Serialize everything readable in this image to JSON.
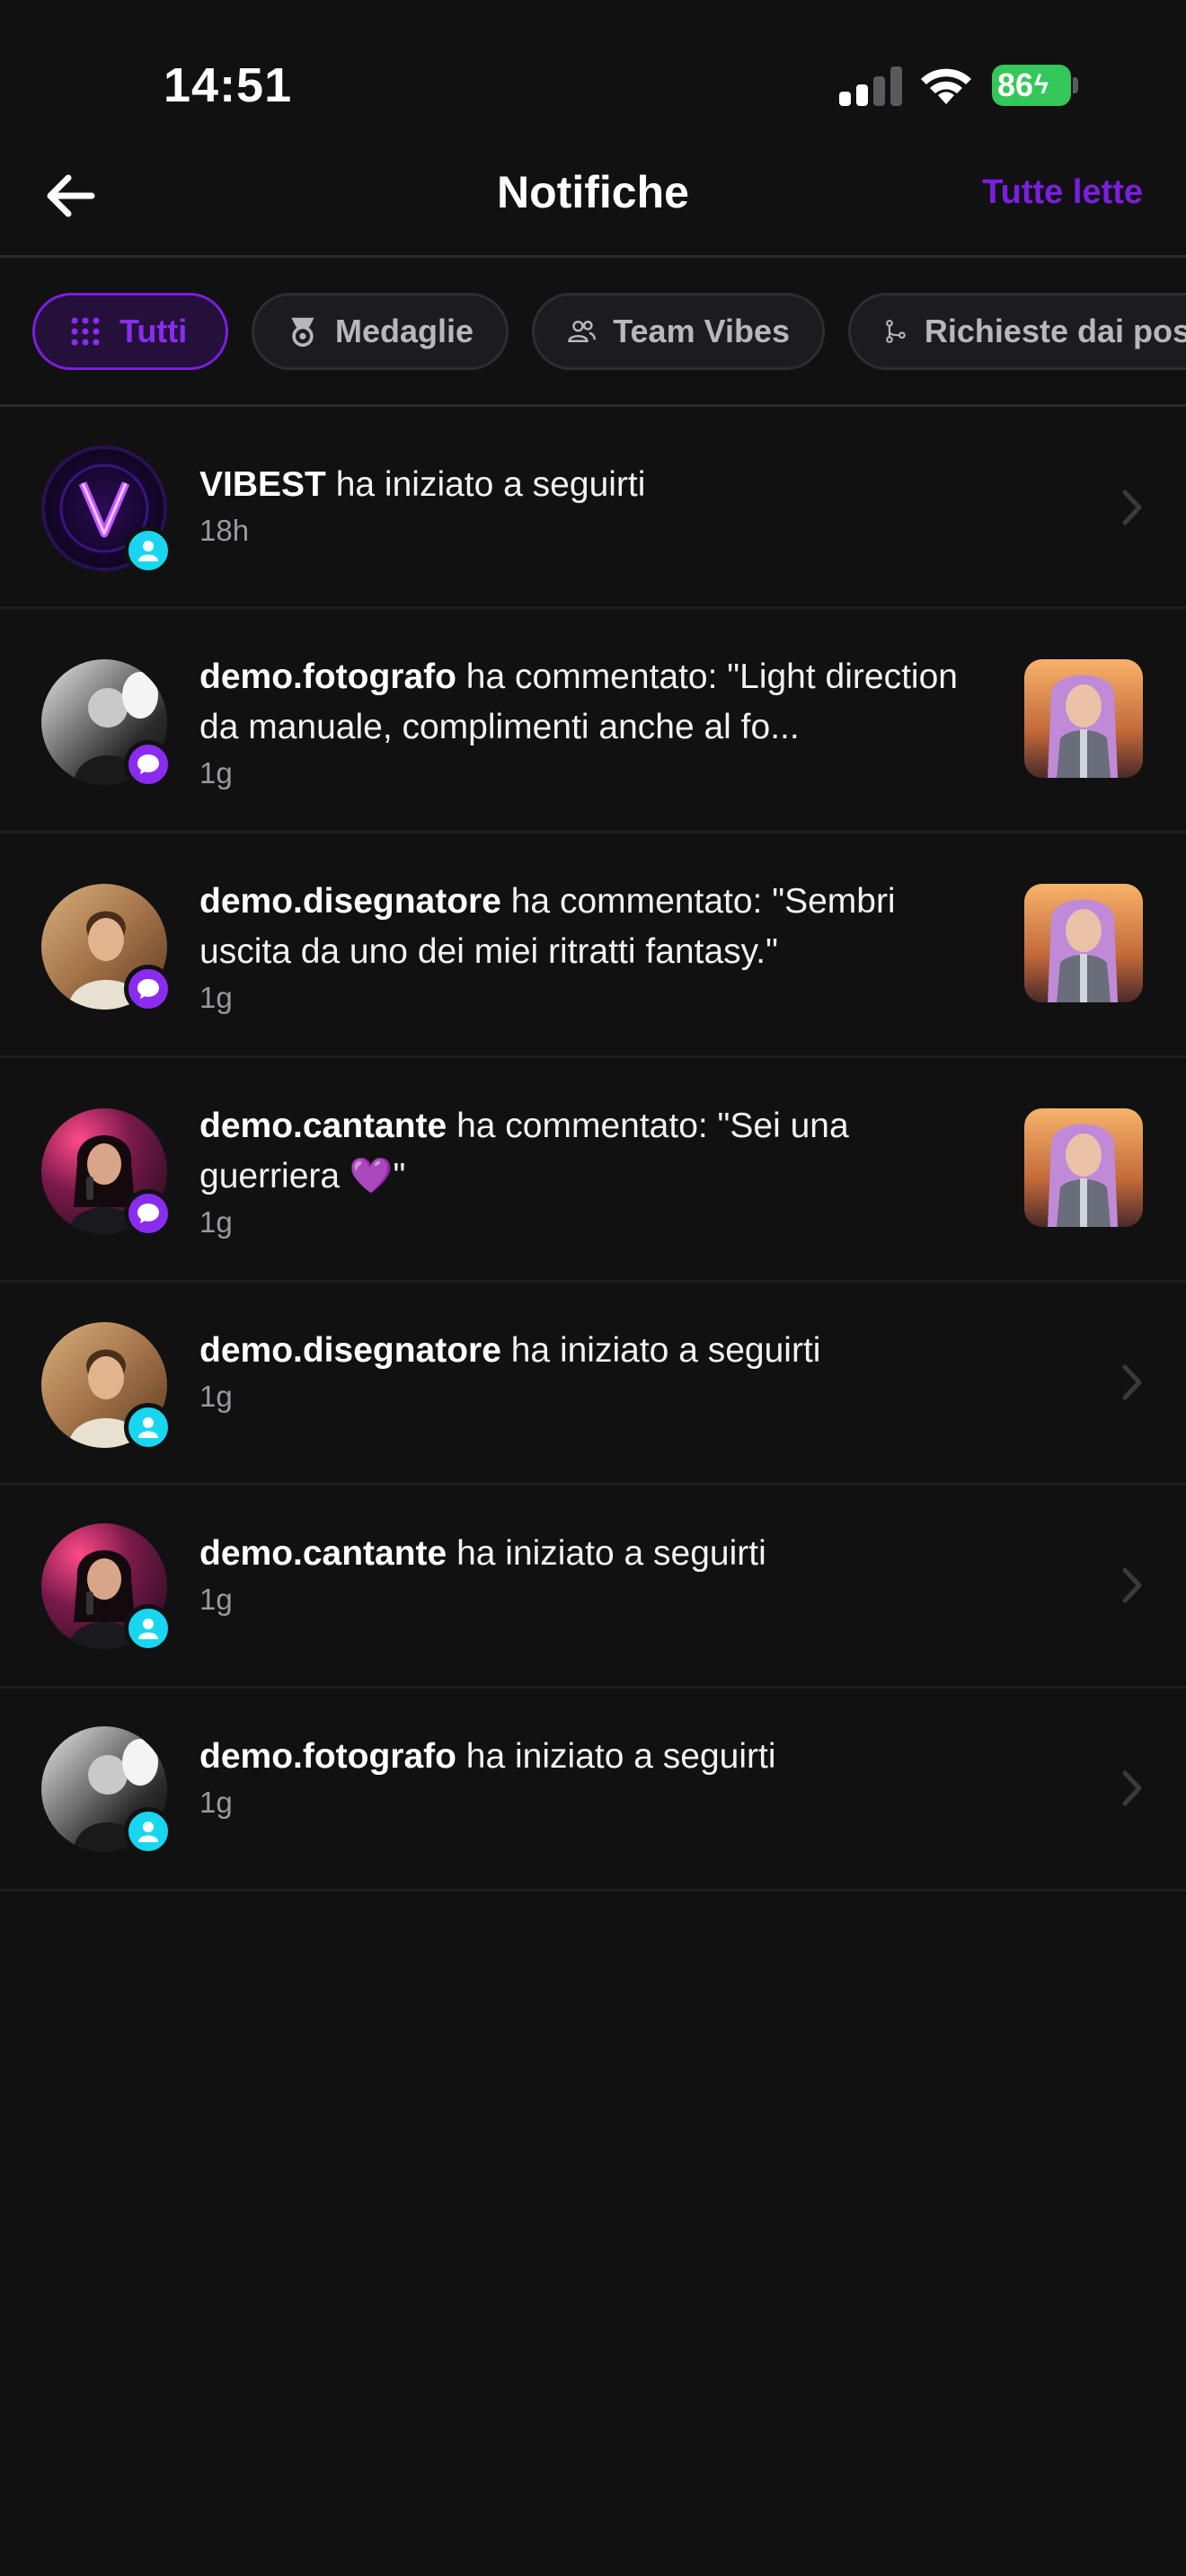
{
  "status_bar": {
    "time": "14:51",
    "battery": "86"
  },
  "header": {
    "title": "Notifiche",
    "mark_all_read": "Tutte lette",
    "back_icon": "arrow-left-icon"
  },
  "filters": [
    {
      "label": "Tutti",
      "icon": "grid-dots-icon",
      "active": true
    },
    {
      "label": "Medaglie",
      "icon": "medal-icon",
      "active": false
    },
    {
      "label": "Team Vibes",
      "icon": "users-icon",
      "active": false
    },
    {
      "label": "Richieste dai pos",
      "icon": "branch-icon",
      "active": false
    }
  ],
  "notifications": [
    {
      "user": "VIBEST",
      "text": " ha iniziato a seguirti",
      "time": "18h",
      "type": "follow"
    },
    {
      "user": "demo.fotografo",
      "text": " ha commentato: \"Light direction da manuale, complimenti anche al fo...",
      "time": "1g",
      "type": "comment"
    },
    {
      "user": "demo.disegnatore",
      "text": " ha commentato: \"Sembri uscita da uno dei miei ritratti fantasy.\"",
      "time": "1g",
      "type": "comment"
    },
    {
      "user": "demo.cantante",
      "text": " ha commentato: \"Sei una guerriera 💜\"",
      "time": "1g",
      "type": "comment"
    },
    {
      "user": "demo.disegnatore",
      "text": " ha iniziato a seguirti",
      "time": "1g",
      "type": "follow"
    },
    {
      "user": "demo.cantante",
      "text": " ha iniziato a seguirti",
      "time": "1g",
      "type": "follow"
    },
    {
      "user": "demo.fotografo",
      "text": " ha iniziato a seguirti",
      "time": "1g",
      "type": "follow"
    }
  ],
  "colors": {
    "accent": "#7b1ee0",
    "follow_badge": "#18d6f0",
    "comment_badge": "#8a2cf0",
    "background": "#111112"
  }
}
